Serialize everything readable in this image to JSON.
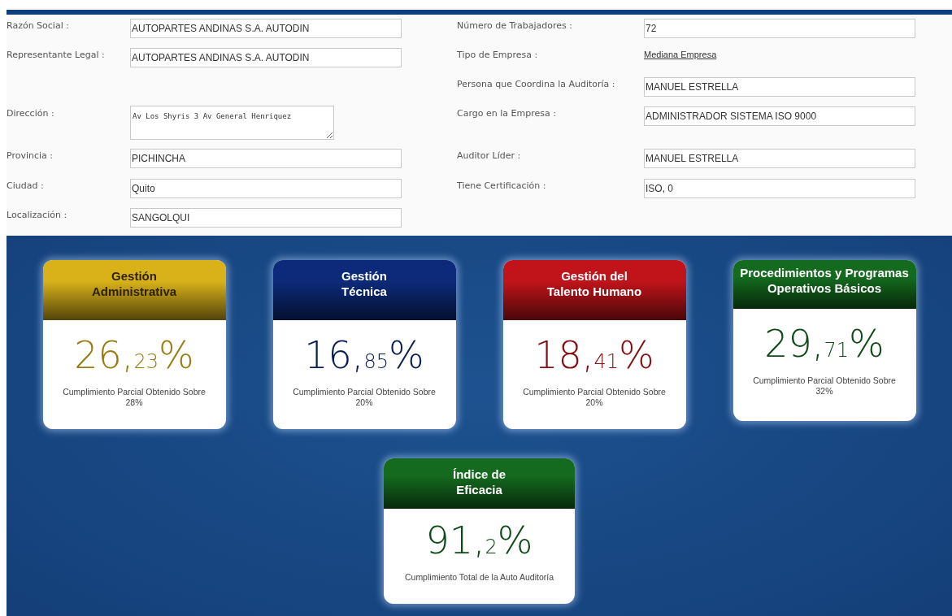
{
  "form": {
    "rows": [
      {
        "left": {
          "label": "Razón Social :",
          "kind": "input",
          "value": "AUTOPARTES ANDINAS S.A. AUTODIN"
        },
        "right": {
          "label": "Número de Trabajadores :",
          "kind": "input",
          "value": "72"
        }
      },
      {
        "left": {
          "label": "Representante Legal :",
          "kind": "input",
          "value": "AUTOPARTES ANDINAS S.A. AUTODIN"
        },
        "right": {
          "label": "Tipo de Empresa :",
          "kind": "link",
          "value": "Mediana Empresa"
        }
      },
      {
        "right": {
          "label": "Persona que Coordina la Auditoría :",
          "kind": "input",
          "value": "MANUEL ESTRELLA"
        }
      },
      {
        "left": {
          "label": "Dirección :",
          "kind": "textarea",
          "value": "Av Los Shyris 3 Av General Henriquez"
        },
        "right": {
          "label": "Cargo en la Empresa :",
          "kind": "input",
          "value": "ADMINISTRADOR SISTEMA ISO 9000"
        }
      },
      {
        "left": {
          "label": "Provincia :",
          "kind": "input",
          "value": "PICHINCHA"
        },
        "right": {
          "label": "Auditor Líder :",
          "kind": "input",
          "value": "MANUEL ESTRELLA"
        }
      },
      {
        "left": {
          "label": "Ciudad :",
          "kind": "input",
          "value": "Quito"
        },
        "right": {
          "label": "Tiene Certificación :",
          "kind": "input",
          "value": "ISO, 0"
        }
      },
      {
        "left": {
          "label": "Localización :",
          "kind": "input",
          "value": "SANGOLQUI"
        }
      }
    ]
  },
  "cards": [
    {
      "title_lines": [
        "Gestión",
        "Administrativa"
      ],
      "color": "#d9b21a",
      "value": {
        "main": "26,",
        "small": "23",
        "unit": "%"
      },
      "caption": "Cumplimiento Parcial Obtenido Sobre 28%"
    },
    {
      "title_lines": [
        "Gestión",
        "Técnica"
      ],
      "color": "#0d2a7a",
      "value": {
        "main": "16,",
        "small": "85",
        "unit": "%"
      },
      "caption": "Cumplimiento Parcial Obtenido Sobre 20%"
    },
    {
      "title_lines": [
        "Gestión del",
        "Talento Humano"
      ],
      "color": "#c0141a",
      "value": {
        "main": "18,",
        "small": "41",
        "unit": "%"
      },
      "caption": "Cumplimiento Parcial Obtenido Sobre 20%"
    },
    {
      "title_lines": [
        "Procedimientos y Programas",
        "Operativos Básicos"
      ],
      "color": "#146a1e",
      "value": {
        "main": "29,",
        "small": "71",
        "unit": "%"
      },
      "caption": "Cumplimiento Parcial Obtenido Sobre 32%"
    }
  ],
  "summary_card": {
    "title_lines": [
      "Índice de",
      "Eficacia"
    ],
    "color": "#146a1e",
    "value": {
      "main": "91,",
      "small": "2",
      "unit": "%"
    },
    "caption": "Cumplimiento Total de la Auto Auditoría"
  }
}
